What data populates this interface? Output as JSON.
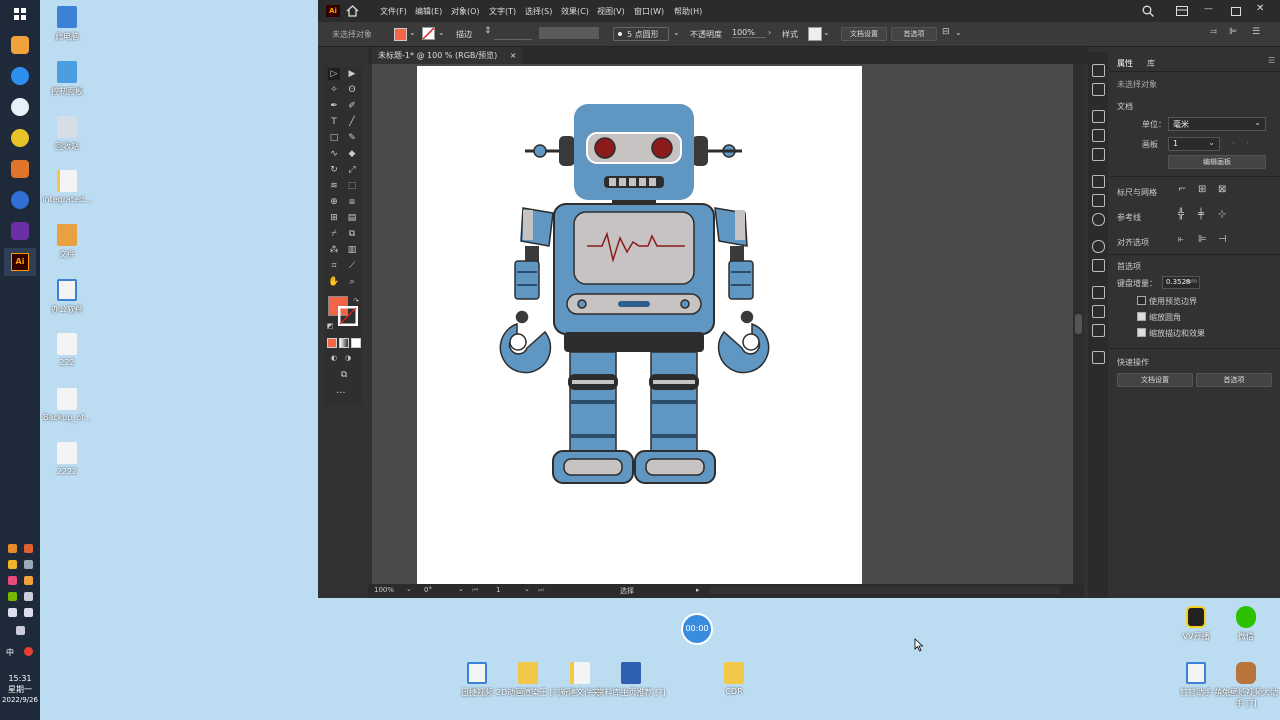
{
  "taskbar": {
    "clock_time": "15:31",
    "clock_day": "星期一",
    "clock_date": "2022/9/26",
    "ime": "中"
  },
  "desktop_left": [
    {
      "label": "此电脑"
    },
    {
      "label": "控制面板"
    },
    {
      "label": "回收站"
    },
    {
      "label": "integrated..."
    },
    {
      "label": "文件"
    },
    {
      "label": "办公软件"
    },
    {
      "label": "222"
    },
    {
      "label": "Backup_of..."
    },
    {
      "label": "2222"
    }
  ],
  "desktop_bottom": [
    {
      "label": "迅捷视频"
    },
    {
      "label": "2D动画渲染王 [?]"
    },
    {
      "label": "新建文件夹"
    },
    {
      "label": "资料库主页推荐 [?]"
    },
    {
      "label": "CDR"
    }
  ],
  "desktop_right": [
    {
      "label": "VV开播"
    },
    {
      "label": "微信"
    },
    {
      "label": "钉钉助手"
    },
    {
      "label": "萌兔壁纸视频大助手 [?]"
    }
  ],
  "timer": "00:00",
  "ai": {
    "logo": "Ai",
    "menus": [
      "文件(F)",
      "编辑(E)",
      "对象(O)",
      "文字(T)",
      "选择(S)",
      "效果(C)",
      "视图(V)",
      "窗口(W)",
      "帮助(H)"
    ],
    "control": {
      "no_selection": "未选择对象",
      "stroke_label": "描边",
      "brush_label": "5 点圆形",
      "opacity_label": "不透明度",
      "opacity_value": "100%",
      "style_label": "样式",
      "doc_setup": "文档设置",
      "preferences": "首选项"
    },
    "tab_title": "未标题-1* @ 100 % (RGB/预览)",
    "tab_close": "×",
    "tools_more": "···",
    "status": {
      "zoom": "100%",
      "angle": "0°",
      "artboard": "1",
      "tool": "选择"
    },
    "panel": {
      "tab_properties": "属性",
      "tab_library": "库",
      "no_selection": "未选择对象",
      "document": "文档",
      "units_label": "单位：",
      "units_value": "毫米",
      "artboard_label": "画板",
      "artboard_value": "1",
      "edit_artboards": "编辑画板",
      "rulers_grids": "标尺与网格",
      "guides": "参考线",
      "align_options": "对齐选项",
      "preferences": "首选项",
      "keyboard_increment_label": "键盘增量：",
      "keyboard_increment_value": "0.3528",
      "keyboard_increment_unit": "mm",
      "use_preview_bounds": "使用预览边界",
      "scale_corners": "缩放圆角",
      "scale_strokes": "缩放描边和效果",
      "quick_actions": "快速操作",
      "doc_setup_btn": "文档设置",
      "prefs_btn": "首选项"
    },
    "colors": {
      "fill": "#f26549",
      "robot_blue": "#5f96c2",
      "robot_dark": "#2d2d2d",
      "robot_grey": "#c8c3c3",
      "robot_eye": "#8b1a1a"
    }
  }
}
